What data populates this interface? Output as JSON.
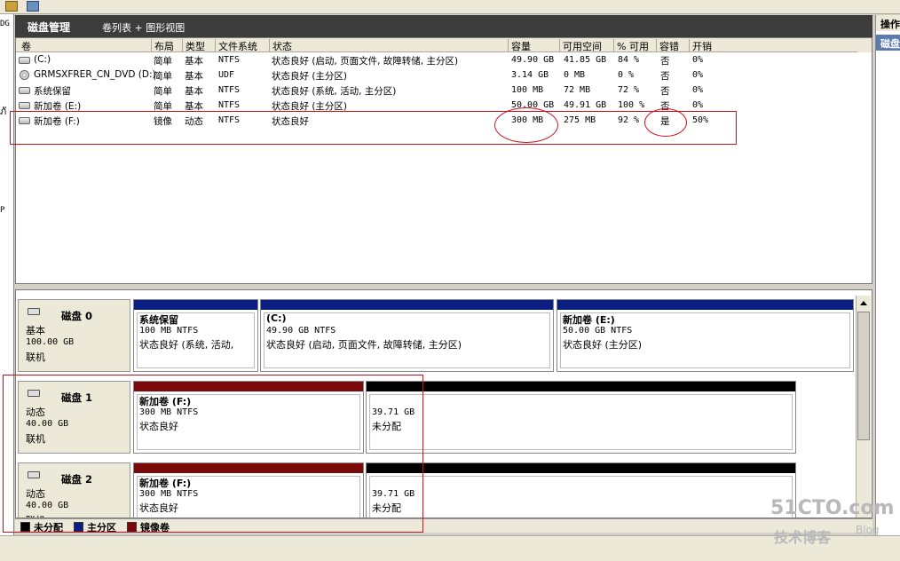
{
  "window": {
    "title": "磁盘管理",
    "view": "卷列表 + 图形视图"
  },
  "side_left": [
    "DG",
    "ภั",
    "P"
  ],
  "right_pane": {
    "header": "操作",
    "item": "磁盘"
  },
  "table": {
    "columns": [
      "卷",
      "布局",
      "类型",
      "文件系统",
      "状态",
      "容量",
      "可用空间",
      "% 可用",
      "容错",
      "开销"
    ],
    "rows": [
      {
        "icon": "drive",
        "vol": "(C:)",
        "layout": "简单",
        "type": "基本",
        "fs": "NTFS",
        "status": "状态良好 (启动, 页面文件, 故障转储, 主分区)",
        "cap": "49.90 GB",
        "free": "41.85 GB",
        "pct": "84 %",
        "ft": "否",
        "oh": "0%"
      },
      {
        "icon": "cd",
        "vol": "GRMSXFRER_CN_DVD (D:)",
        "layout": "简单",
        "type": "基本",
        "fs": "UDF",
        "status": "状态良好 (主分区)",
        "cap": "3.14 GB",
        "free": "0 MB",
        "pct": "0 %",
        "ft": "否",
        "oh": "0%"
      },
      {
        "icon": "drive",
        "vol": "系统保留",
        "layout": "简单",
        "type": "基本",
        "fs": "NTFS",
        "status": "状态良好 (系统, 活动, 主分区)",
        "cap": "100 MB",
        "free": "72 MB",
        "pct": "72 %",
        "ft": "否",
        "oh": "0%"
      },
      {
        "icon": "drive",
        "vol": "新加卷 (E:)",
        "layout": "简单",
        "type": "基本",
        "fs": "NTFS",
        "status": "状态良好 (主分区)",
        "cap": "50.00 GB",
        "free": "49.91 GB",
        "pct": "100 %",
        "ft": "否",
        "oh": "0%"
      },
      {
        "icon": "drive",
        "vol": "新加卷 (F:)",
        "layout": "镜像",
        "type": "动态",
        "fs": "NTFS",
        "status": "状态良好",
        "cap": "300 MB",
        "free": "275 MB",
        "pct": "92 %",
        "ft": "是",
        "oh": "50%"
      }
    ]
  },
  "disks": [
    {
      "name": "磁盘 0",
      "kind": "基本",
      "size": "100.00 GB",
      "state": "联机",
      "partitions": [
        {
          "title": "系统保留",
          "size": "100 MB NTFS",
          "status": "状态良好 (系统, 活动,",
          "bar": "#0a1e82"
        },
        {
          "title": "(C:)",
          "size": "49.90 GB NTFS",
          "status": "状态良好 (启动, 页面文件, 故障转储, 主分区)",
          "bar": "#0a1e82"
        },
        {
          "title": "新加卷  (E:)",
          "size": "50.00 GB NTFS",
          "status": "状态良好 (主分区)",
          "bar": "#0a1e82"
        }
      ]
    },
    {
      "name": "磁盘 1",
      "kind": "动态",
      "size": "40.00 GB",
      "state": "联机",
      "partitions": [
        {
          "title": "新加卷  (F:)",
          "size": "300 MB NTFS",
          "status": "状态良好",
          "bar": "#7a0a0a"
        },
        {
          "title": "",
          "size": "39.71 GB",
          "status": "未分配",
          "bar": "#000000"
        }
      ]
    },
    {
      "name": "磁盘 2",
      "kind": "动态",
      "size": "40.00 GB",
      "state": "联机",
      "partitions": [
        {
          "title": "新加卷  (F:)",
          "size": "300 MB NTFS",
          "status": "状态良好",
          "bar": "#7a0a0a"
        },
        {
          "title": "",
          "size": "39.71 GB",
          "status": "未分配",
          "bar": "#000000"
        }
      ]
    }
  ],
  "legend": [
    {
      "label": "未分配",
      "color": "#000000"
    },
    {
      "label": "主分区",
      "color": "#0a1e82"
    },
    {
      "label": "镜像卷",
      "color": "#7a0a0a"
    }
  ],
  "watermark": {
    "brand": "51CTO.com",
    "sub": "技术博客",
    "blog": "Blog"
  }
}
